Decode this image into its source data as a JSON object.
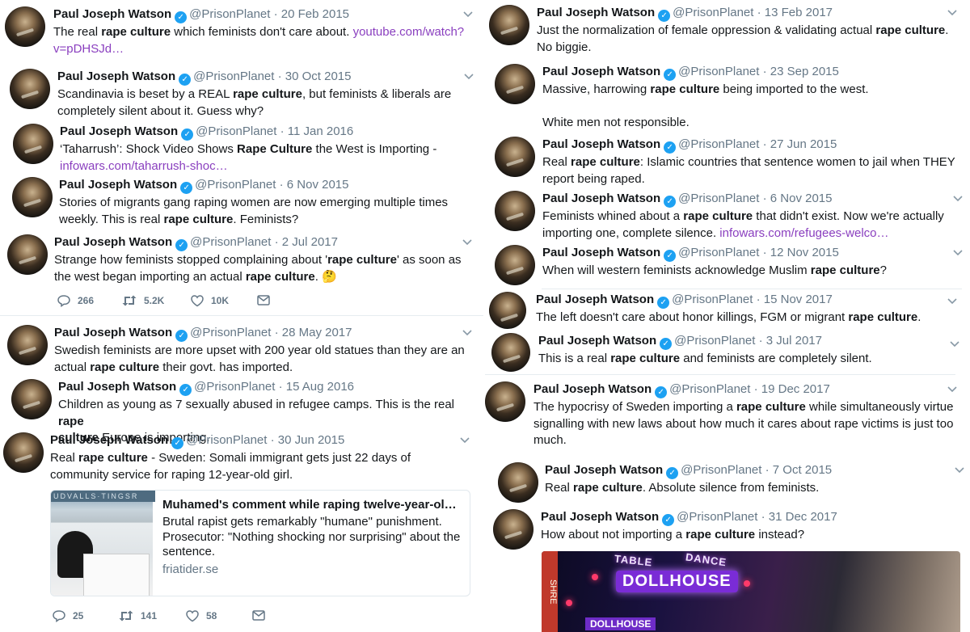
{
  "name": "Paul Joseph Watson",
  "handle": "@PrisonPlanet",
  "dot": "·",
  "emph": "rape culture",
  "left": {
    "t1": {
      "date": "20 Feb 2015",
      "pre": "The real ",
      "post": " which feminists don't care about. ",
      "link": "youtube.com/watch?v=pDHSJd…"
    },
    "t2": {
      "date": "30 Oct 2015",
      "pre": "Scandinavia is beset by a REAL ",
      "post": ", but feminists & liberals are completely silent about it. Guess why?"
    },
    "t3": {
      "date": "11 Jan 2016",
      "pre": "‘Taharrush’: Shock Video Shows ",
      "emph": "Rape Culture",
      "post": " the West is Importing - ",
      "link": "infowars.com/taharrush-shoc…"
    },
    "t4": {
      "date": "6 Nov 2015",
      "pre": "Stories of migrants gang raping women are now emerging multiple times weekly. This is real ",
      "post": ". Feminists?"
    },
    "t5": {
      "date": "2 Jul 2017",
      "pre": "Strange how feminists stopped complaining about '",
      "mid": "' as soon as the west began importing an actual ",
      "post": ". 🤔",
      "reply_count": "266",
      "retweet_count": "5.2K",
      "like_count": "10K"
    },
    "t6": {
      "date": "28 May 2017",
      "pre": "Swedish feminists are more upset with 200 year old statues than they are an actual ",
      "post": " their govt. has imported."
    },
    "t7": {
      "date": "15 Aug 2016",
      "pre": "Children as young as 7 sexually abused in refugee camps. This is the real ",
      "emph_a": "rape",
      "emph_b": "culture",
      "post": " Europe is importing."
    },
    "t8": {
      "date": "30 Jun 2015",
      "pre": "Real ",
      "post": " - Sweden: Somali immigrant gets just 22 days of community service for raping 12-year-old girl.",
      "card_title": "Muhamed's comment while raping twelve-year-old …",
      "card_desc": "Brutal rapist gets remarkably \"humane\" punishment. Prosecutor: \"Nothing shocking nor surprising\" about the sentence.",
      "card_domain": "friatider.se",
      "card_sign": "UDVALLS·TINGSR",
      "reply_count": "25",
      "retweet_count": "141",
      "like_count": "58"
    }
  },
  "right": {
    "r1": {
      "date": "13 Feb 2017",
      "pre": "Just the normalization of female oppression & validating actual ",
      "post": ". No biggie."
    },
    "r2": {
      "date": "23 Sep 2015",
      "pre": "Massive, harrowing ",
      "post": " being imported to the west.",
      "line2": "White men not responsible."
    },
    "r3": {
      "date": "27 Jun 2015",
      "pre": "Real ",
      "post": ": Islamic countries that sentence women to jail when THEY report being raped."
    },
    "r4": {
      "date": "6 Nov 2015",
      "pre": "Feminists whined about a ",
      "post": " that didn't exist. Now we're actually importing one, complete silence. ",
      "link": "infowars.com/refugees-welco…"
    },
    "r5": {
      "date": "12 Nov 2015",
      "pre": "When will western feminists acknowledge Muslim ",
      "post": "?"
    },
    "r6": {
      "date": "15 Nov 2017",
      "pre": "The left doesn't care about honor killings, FGM or migrant ",
      "post": "."
    },
    "r7": {
      "date": "3 Jul 2017",
      "pre": "This is a real ",
      "post": " and feminists are completely silent."
    },
    "r8": {
      "date": "19 Dec 2017",
      "pre": "The hypocrisy of Sweden importing a ",
      "post": " while simultaneously virtue signalling with new laws about how much it cares about rape victims is just too much."
    },
    "r9": {
      "date": "7 Oct 2015",
      "pre": "Real ",
      "post": ". Absolute silence from feminists."
    },
    "r10": {
      "date": "31 Dec 2017",
      "pre": "How about not importing a ",
      "post": " instead?",
      "media_sign_table": "TABLE",
      "media_sign_dance": "DANCE",
      "media_sign_club": "DOLLHOUSE",
      "media_sign_lower": "DOLLHOUSE",
      "media_side": "SHRE"
    }
  },
  "colors": {
    "link": "#8a3fbf",
    "verified": "#1da1f2",
    "meta": "#657786",
    "text": "#14171a"
  },
  "icons": {
    "verified": "verified-badge-icon",
    "caret": "chevron-down-icon",
    "reply": "reply-icon",
    "retweet": "retweet-icon",
    "like": "heart-icon",
    "dm": "envelope-icon"
  }
}
